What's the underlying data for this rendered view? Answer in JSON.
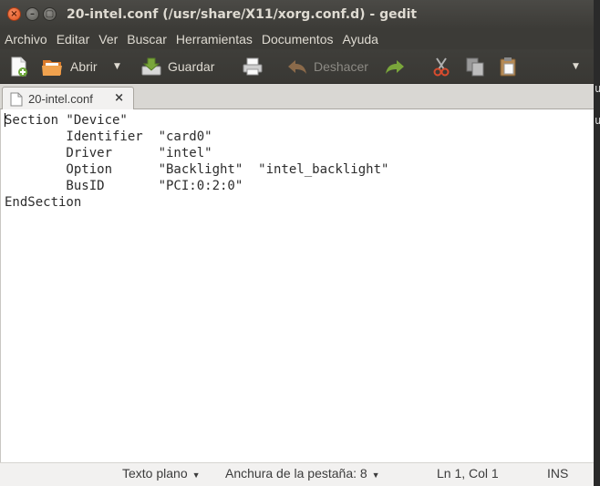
{
  "window": {
    "title": "20-intel.conf (/usr/share/X11/xorg.conf.d) - gedit",
    "controls": {
      "close": "×",
      "minimize": "–",
      "maximize": "▢"
    }
  },
  "menubar": {
    "items": [
      "Archivo",
      "Editar",
      "Ver",
      "Buscar",
      "Herramientas",
      "Documentos",
      "Ayuda"
    ]
  },
  "toolbar": {
    "open_label": "Abrir",
    "save_label": "Guardar",
    "undo_label": "Deshacer"
  },
  "tab": {
    "label": "20-intel.conf",
    "close": "×"
  },
  "editor": {
    "lines": [
      "Section \"Device\"",
      "        Identifier  \"card0\"",
      "        Driver      \"intel\"",
      "        Option      \"Backlight\"  \"intel_backlight\"",
      "        BusID       \"PCI:0:2:0\"",
      "EndSection"
    ]
  },
  "statusbar": {
    "language": "Texto plano",
    "tab_width": "Anchura de la pestaña: 8",
    "position": "Ln 1, Col 1",
    "mode": "INS"
  },
  "background_terminal": {
    "glyph_1": "u",
    "glyph_2": "u"
  },
  "colors": {
    "titlebar": "#3c3b37",
    "close_button": "#e0541f",
    "accent_green": "#7aa63b",
    "accent_red": "#d94c2e"
  }
}
